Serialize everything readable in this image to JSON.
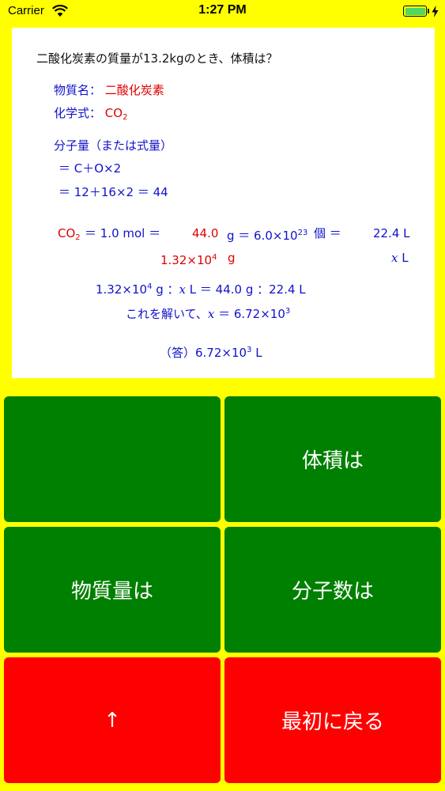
{
  "status_bar": {
    "carrier": "Carrier",
    "time": "1:27 PM"
  },
  "problem": {
    "question": "二酸化炭素の質量が13.2kgのとき、体積は？",
    "substance_label": "物質名：",
    "substance_name": "二酸化炭素",
    "formula_label": "化学式：",
    "formula_main": "CO",
    "formula_sub": "2",
    "mw_label": "分子量（または式量）",
    "mw_line1": "＝ C＋O×2",
    "mw_line2": "＝ 12＋16×2 ＝ 44",
    "rel_co2_main": "CO",
    "rel_co2_sub": "2",
    "rel_mol": "＝ 1.0 mol ＝",
    "rel_mass": "44.0",
    "rel_g_eq": "g ＝ 6.0×10",
    "rel_exp": "23",
    "rel_ko_eq": "個 ＝",
    "rel_vol": "22.4 L",
    "given_mass": "1.32×10",
    "given_exp": "4",
    "given_unit": "g",
    "given_var": "x",
    "given_var_unit": "L",
    "prop_a": "1.32×10",
    "prop_a_exp": "4",
    "prop_b": "g ：",
    "prop_var": "x",
    "prop_c": "L ＝ 44.0 g ：22.4 L",
    "solve_a": "これを解いて、",
    "solve_var": "x",
    "solve_b": "＝ 6.72×10",
    "solve_exp": "3",
    "answer_a": "（答）6.72×10",
    "answer_exp": "3",
    "answer_b": "L"
  },
  "buttons": {
    "top_left": "",
    "volume": "体積は",
    "amount": "物質量は",
    "molecules": "分子数は",
    "up": "↑",
    "back_to_start": "最初に戻る"
  },
  "colors": {
    "background": "#ffff00",
    "green_button": "#008000",
    "red_button": "#ff0000",
    "text_blue": "#1111cc",
    "text_red": "#dd0000"
  }
}
